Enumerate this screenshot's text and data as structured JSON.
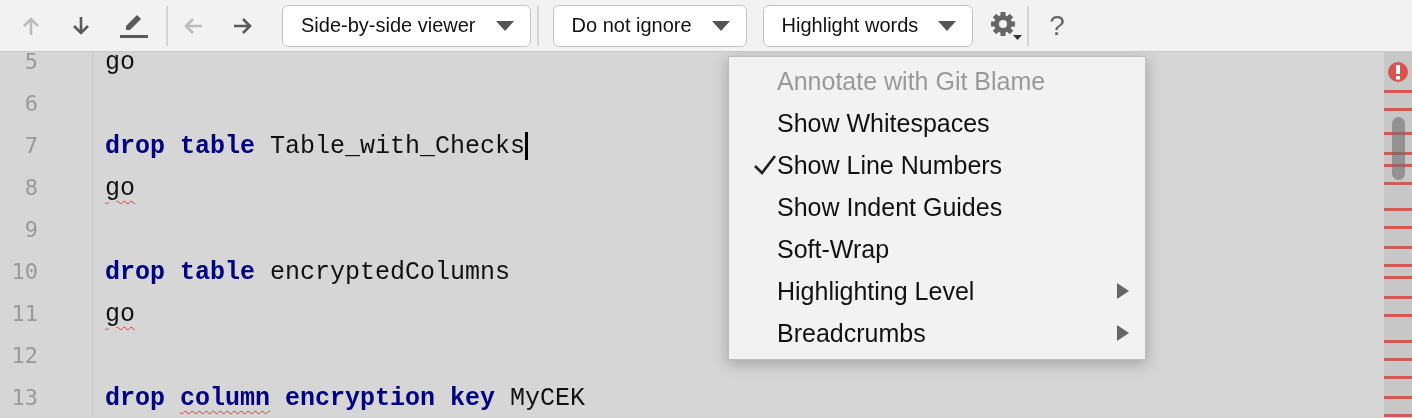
{
  "toolbar": {
    "tools": [
      {
        "kind": "up",
        "disabled": true
      },
      {
        "kind": "down",
        "disabled": false
      },
      {
        "kind": "edit",
        "disabled": false
      },
      {
        "kind": "sep"
      },
      {
        "kind": "back",
        "disabled": true
      },
      {
        "kind": "forward",
        "disabled": false
      }
    ],
    "dropdowns": [
      {
        "label": "Side-by-side viewer"
      },
      {
        "label": "Do not ignore"
      },
      {
        "label": "Highlight words"
      }
    ],
    "help": "?"
  },
  "editor": {
    "lines": [
      {
        "number": "5",
        "caret": false,
        "tokens": [
          {
            "text": "go",
            "kind": "plain",
            "error": false
          }
        ]
      },
      {
        "number": "6",
        "caret": false
      },
      {
        "number": "7",
        "caret": true,
        "tokens": [
          {
            "text": "drop",
            "kind": "keyword",
            "error": false
          },
          {
            "text": "table",
            "kind": "keyword",
            "error": false
          },
          {
            "text": "Table_with_Checks",
            "kind": "plain",
            "error": false
          }
        ]
      },
      {
        "number": "8",
        "caret": false,
        "tokens": [
          {
            "text": "go",
            "kind": "plain",
            "error": true
          }
        ]
      },
      {
        "number": "9",
        "caret": false
      },
      {
        "number": "10",
        "caret": false,
        "tokens": [
          {
            "text": "drop",
            "kind": "keyword",
            "error": false
          },
          {
            "text": "table",
            "kind": "keyword",
            "error": false
          },
          {
            "text": "encryptedColumns",
            "kind": "plain",
            "error": false
          }
        ]
      },
      {
        "number": "11",
        "caret": false,
        "tokens": [
          {
            "text": "go",
            "kind": "plain",
            "error": true
          }
        ]
      },
      {
        "number": "12",
        "caret": false
      },
      {
        "number": "13",
        "caret": false,
        "tokens": [
          {
            "text": "drop",
            "kind": "keyword",
            "error": false
          },
          {
            "text": "column",
            "kind": "keyword",
            "error": true
          },
          {
            "text": "encryption",
            "kind": "keyword",
            "error": false
          },
          {
            "text": "key",
            "kind": "keyword",
            "error": false
          },
          {
            "text": "MyCEK",
            "kind": "plain",
            "error": false
          }
        ]
      }
    ]
  },
  "menu": {
    "items": [
      {
        "label": "Annotate with Git Blame",
        "disabled": true,
        "checked": false,
        "submenu": false
      },
      {
        "label": "Show Whitespaces",
        "disabled": false,
        "checked": false,
        "submenu": false
      },
      {
        "label": "Show Line Numbers",
        "disabled": false,
        "checked": true,
        "submenu": false
      },
      {
        "label": "Show Indent Guides",
        "disabled": false,
        "checked": false,
        "submenu": false
      },
      {
        "label": "Soft-Wrap",
        "disabled": false,
        "checked": false,
        "submenu": false
      },
      {
        "label": "Highlighting Level",
        "disabled": false,
        "checked": false,
        "submenu": true
      },
      {
        "label": "Breadcrumbs",
        "disabled": false,
        "checked": false,
        "submenu": true
      }
    ]
  }
}
